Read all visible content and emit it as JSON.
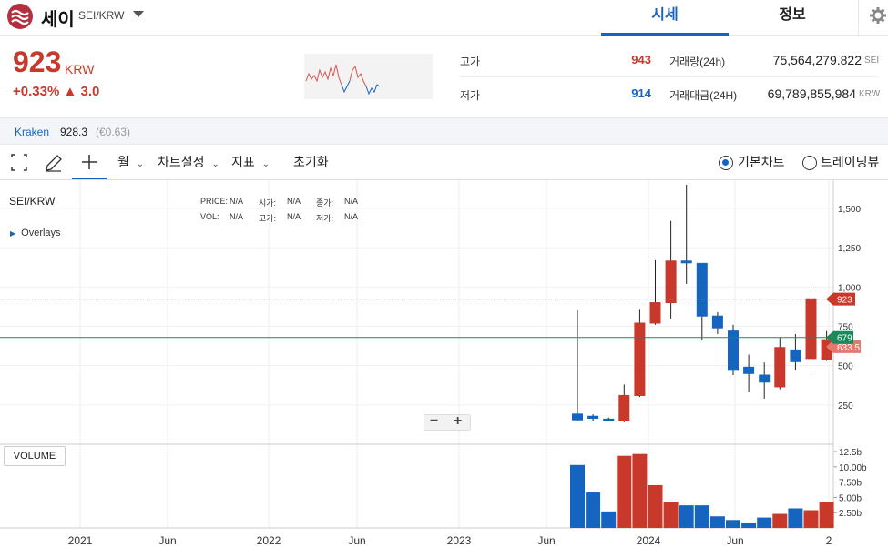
{
  "header": {
    "coin_name": "세이",
    "pair": "SEI/KRW",
    "tabs": [
      "시세",
      "정보"
    ]
  },
  "price": {
    "value": "923",
    "unit": "KRW",
    "change": "+0.33% ▲ 3.0"
  },
  "stats": {
    "high_label": "고가",
    "high": "943",
    "low_label": "저가",
    "low": "914",
    "volume_label": "거래량(24h)",
    "volume": "75,564,279.822",
    "volume_unit": "SEI",
    "amount_label": "거래대금(24H)",
    "amount": "69,789,855,984",
    "amount_unit": "KRW"
  },
  "exchange": {
    "name": "Kraken",
    "price": "928.3",
    "diff": "(€0.63)"
  },
  "toolbar": {
    "interval": "월",
    "chart_settings": "차트설정",
    "indicators": "지표",
    "reset": "초기화",
    "basic_chart": "기본차트",
    "trading_view": "트레이딩뷰"
  },
  "chart_legend": {
    "symbol": "SEI/KRW",
    "overlays": "Overlays",
    "price_label": "PRICE:",
    "price": "N/A",
    "open_label": "시가:",
    "open": "N/A",
    "close_label": "종가:",
    "close": "N/A",
    "vol_label": "VOL:",
    "vol": "N/A",
    "high_label": "고가:",
    "high": "N/A",
    "low_label": "저가:",
    "low": "N/A",
    "volume_button": "VOLUME"
  },
  "colors": {
    "up": "#c8392b",
    "down": "#1565c0",
    "ma": "#1a8a5a"
  },
  "chart_data": {
    "type": "candlestick",
    "price_axis": {
      "ticks": [
        "1,500",
        "1,250",
        "1,000",
        "750",
        "500",
        "250"
      ],
      "range": [
        0,
        1650
      ]
    },
    "volume_axis": {
      "ticks": [
        "12.5b",
        "10.00b",
        "7.50b",
        "5.00b",
        "2.50b"
      ],
      "range": [
        0,
        12.5
      ]
    },
    "time_axis": [
      "2021",
      "Jun",
      "2022",
      "Jun",
      "2023",
      "Jun",
      "2024",
      "Jun",
      "2"
    ],
    "last_price": 923,
    "ma_value": 679,
    "ma_partial_label": "633.5",
    "candles": [
      {
        "o": 192,
        "h": 855,
        "l": 150,
        "c": 155,
        "v": 10.3
      },
      {
        "o": 178,
        "h": 190,
        "l": 150,
        "c": 165,
        "v": 5.8
      },
      {
        "o": 160,
        "h": 170,
        "l": 145,
        "c": 148,
        "v": 2.7
      },
      {
        "o": 148,
        "h": 380,
        "l": 140,
        "c": 310,
        "v": 11.8
      },
      {
        "o": 310,
        "h": 860,
        "l": 300,
        "c": 770,
        "v": 12.1
      },
      {
        "o": 770,
        "h": 1170,
        "l": 760,
        "c": 900,
        "v": 7.0
      },
      {
        "o": 900,
        "h": 1420,
        "l": 800,
        "c": 1165,
        "v": 4.3
      },
      {
        "o": 1165,
        "h": 1650,
        "l": 1020,
        "c": 1155,
        "v": 3.7
      },
      {
        "o": 1150,
        "h": 1150,
        "l": 660,
        "c": 815,
        "v": 3.7
      },
      {
        "o": 815,
        "h": 840,
        "l": 700,
        "c": 740,
        "v": 1.9
      },
      {
        "o": 720,
        "h": 760,
        "l": 440,
        "c": 470,
        "v": 1.3
      },
      {
        "o": 490,
        "h": 570,
        "l": 330,
        "c": 450,
        "v": 0.9
      },
      {
        "o": 440,
        "h": 520,
        "l": 290,
        "c": 395,
        "v": 1.7
      },
      {
        "o": 365,
        "h": 680,
        "l": 350,
        "c": 615,
        "v": 2.3
      },
      {
        "o": 600,
        "h": 700,
        "l": 470,
        "c": 525,
        "v": 3.2
      },
      {
        "o": 545,
        "h": 990,
        "l": 460,
        "c": 925,
        "v": 2.9
      },
      {
        "o": 540,
        "h": 720,
        "l": 530,
        "c": 665,
        "v": 4.3
      }
    ]
  }
}
